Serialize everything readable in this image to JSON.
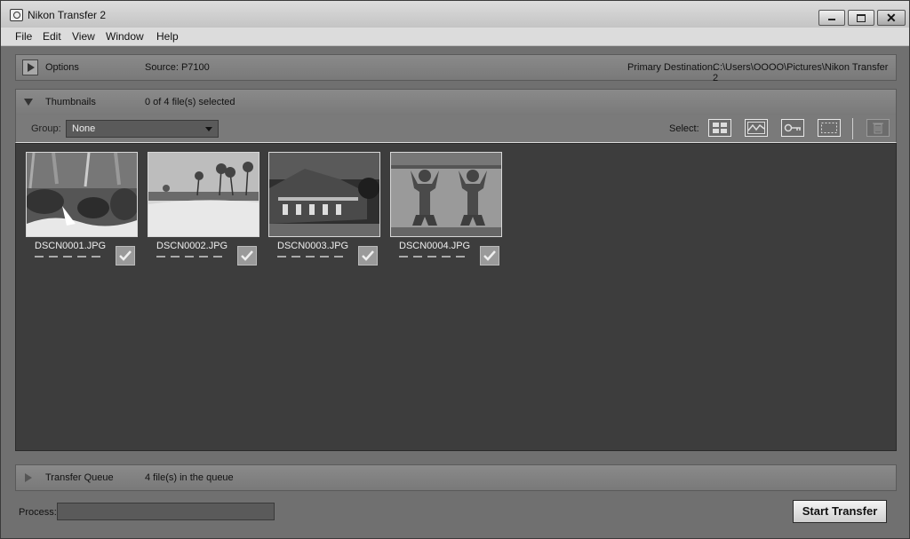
{
  "window": {
    "title": "Nikon Transfer 2"
  },
  "menu": [
    "File",
    "Edit",
    "View",
    "Window",
    "Help"
  ],
  "options_panel": {
    "label": "Options",
    "source": "Source: P7100",
    "destination_label": "Primary Destination:",
    "destination_path": "C:\\Users\\OOOO\\Pictures\\Nikon Transfer 2"
  },
  "thumbnails_panel": {
    "label": "Thumbnails",
    "status": "0 of 4 file(s) selected"
  },
  "toolbar": {
    "group_label": "Group:",
    "group_value": "None",
    "select_label": "Select:",
    "buttons": [
      "select-all-icon",
      "select-new-icon",
      "select-protected-icon",
      "deselect-all-icon",
      "trash-icon"
    ]
  },
  "files": [
    {
      "name": "DSCN0001.JPG",
      "checked": true,
      "scene": "waterfall"
    },
    {
      "name": "DSCN0002.JPG",
      "checked": true,
      "scene": "beach with palm trees"
    },
    {
      "name": "DSCN0003.JPG",
      "checked": true,
      "scene": "building at night"
    },
    {
      "name": "DSCN0004.JPG",
      "checked": true,
      "scene": "temple statues"
    }
  ],
  "queue_panel": {
    "label": "Transfer Queue",
    "status": "4 file(s) in the queue"
  },
  "status": {
    "process_label": "Process:",
    "start_button": "Start Transfer"
  }
}
